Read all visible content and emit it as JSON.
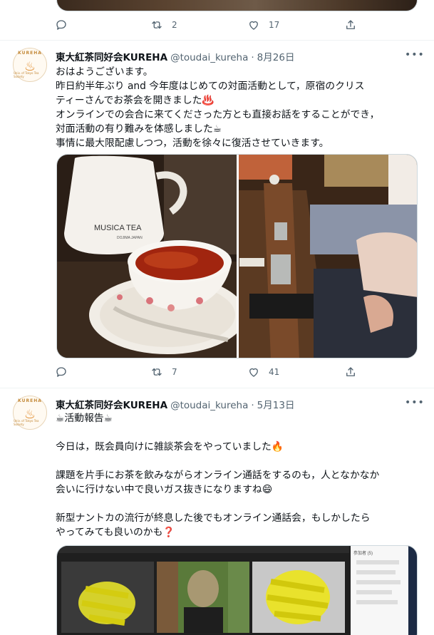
{
  "top_tweet": {
    "reply_count": "",
    "retweet_count": "2",
    "like_count": "17"
  },
  "tweet1": {
    "avatar_text": "KUREHA",
    "avatar_subtext": "Univ. of Tokyo Tea Society",
    "display_name": "東大紅茶同好会KUREHA",
    "handle": "@toudai_kureha",
    "separator": "·",
    "date": "8月26日",
    "more": "•••",
    "text": "おはようございます。\n昨日約半年ぶり and 今年度はじめての対面活動として，原宿のクリス\nティーさんでお茶会を開きました♨️\nオンラインでの会合に来てくださった方とも直接お話をすることができ，\n対面活動の有り難みを体感しました☕\n事情に最大限配慮しつつ，活動を徐々に復活させていきます。",
    "image_left_text": "MUSICA  TEA",
    "image_left_subtext": "DOJIMA JAPAN",
    "reply_count": "",
    "retweet_count": "7",
    "like_count": "41"
  },
  "tweet2": {
    "avatar_text": "KUREHA",
    "avatar_subtext": "Univ. of Tokyo Tea Society",
    "display_name": "東大紅茶同好会KUREHA",
    "handle": "@toudai_kureha",
    "separator": "·",
    "date": "5月13日",
    "more": "•••",
    "text": "☕活動報告☕\n\n今日は，既会員向けに雑談茶会をやっていました🔥\n\n課題を片手にお茶を飲みながらオンライン通話をするのも，人となかなか\n会いに行けない中で良いガス抜きになりますね😄\n\n新型ナントカの流行が終息した後でもオンライン通話会，もしかしたら\nやってみても良いのかも❓",
    "panel_title": "参加者 (5)"
  },
  "colors": {
    "text_primary": "#0f1419",
    "text_secondary": "#536471",
    "border": "#cfd9de",
    "divider": "#eff3f4",
    "avatar_accent": "#e08a2a"
  },
  "icons": [
    "reply-icon",
    "retweet-icon",
    "like-icon",
    "share-icon",
    "teapot-icon"
  ]
}
